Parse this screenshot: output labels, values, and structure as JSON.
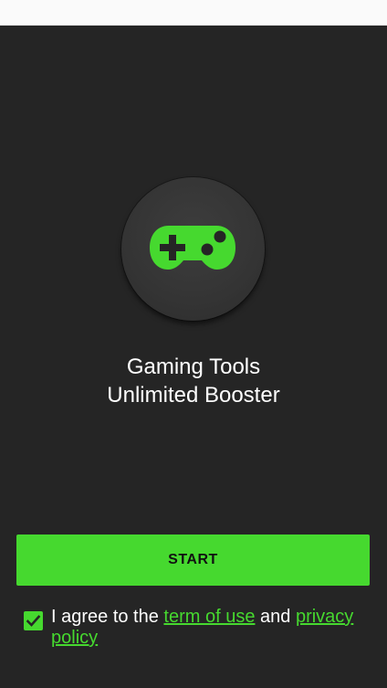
{
  "app": {
    "title_line1": "Gaming Tools",
    "title_line2": "Unlimited Booster",
    "logo_icon": "gamepad-icon"
  },
  "start_button": {
    "label": "START"
  },
  "agreement": {
    "checked": true,
    "text_prefix": "I agree to the ",
    "terms_link": "term of use",
    "conjunction": " and ",
    "privacy_link": "privacy policy"
  },
  "colors": {
    "accent": "#46d92f",
    "background": "#252525",
    "logo_circle": "#363636",
    "text": "#ffffff"
  }
}
